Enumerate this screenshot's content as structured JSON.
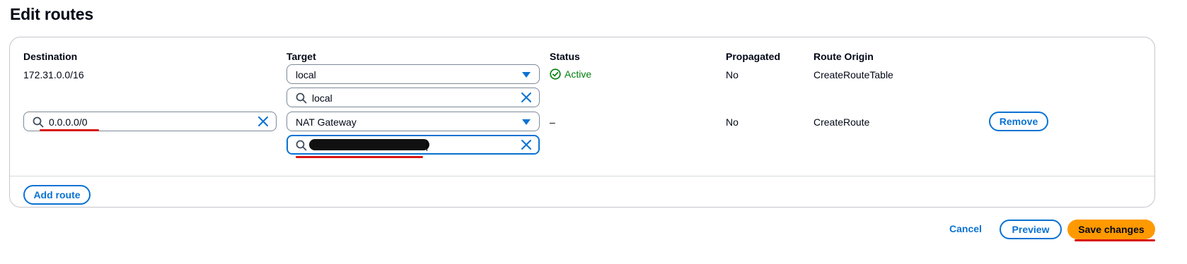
{
  "page": {
    "title": "Edit routes"
  },
  "columns": {
    "destination": "Destination",
    "target": "Target",
    "status": "Status",
    "propagated": "Propagated",
    "route_origin": "Route Origin"
  },
  "rows": [
    {
      "destination": "172.31.0.0/16",
      "target_select": "local",
      "target_search": "local",
      "status": "Active",
      "propagated": "No",
      "route_origin": "CreateRouteTable"
    },
    {
      "destination_search": "0.0.0.0/0",
      "target_select": "NAT Gateway",
      "target_search": "",
      "status": "–",
      "propagated": "No",
      "route_origin": "CreateRoute",
      "remove_label": "Remove"
    }
  ],
  "actions": {
    "add_route": "Add route",
    "cancel": "Cancel",
    "preview": "Preview",
    "save": "Save changes"
  },
  "colors": {
    "accent": "#0972d3",
    "primary_button": "#ff9900",
    "status_success": "#037f0c",
    "annotation": "#d91515"
  },
  "icons": {
    "status": "check-circle-icon",
    "search": "search-icon",
    "clear": "close-icon",
    "dropdown": "caret-down-icon"
  }
}
